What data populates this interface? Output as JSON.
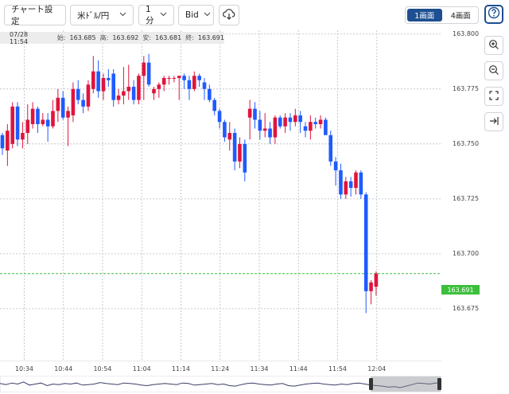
{
  "toolbar": {
    "chart_settings": "チャート設定",
    "pair": "米ﾄﾞﾙ/円",
    "timeframe": "1分",
    "price_type": "Bid",
    "layout_1": "1画面",
    "layout_4": "4画面"
  },
  "ohlc": {
    "datetime": "07/28 11:54",
    "open_label": "始:",
    "open": "163.685",
    "high_label": "高:",
    "high": "163.692",
    "low_label": "安:",
    "low": "163.681",
    "close_label": "終:",
    "close": "163.691"
  },
  "current_price": "163.691",
  "colors": {
    "up": "#e0143c",
    "down": "#1f5bff",
    "grid": "#b8bcc4",
    "current": "#3cc03c",
    "accent": "#1d4f91"
  },
  "icons": [
    "chevron-down-icon",
    "cloud-download-icon",
    "help-icon",
    "zoom-in-icon",
    "zoom-out-icon",
    "fit-icon",
    "scroll-end-icon"
  ],
  "chart_data": {
    "type": "candlestick",
    "interval": "1 minute",
    "y_ticks": [
      "163.800",
      "163.775",
      "163.750",
      "163.725",
      "163.700",
      "163.675"
    ],
    "ylim": [
      163.667,
      163.801
    ],
    "x_ticks": [
      "10:34",
      "10:44",
      "10:54",
      "11:04",
      "11:14",
      "11:24",
      "11:34",
      "11:44",
      "11:54",
      "12:04"
    ],
    "candles": [
      [
        163.754,
        163.755,
        163.745,
        163.748
      ],
      [
        163.747,
        163.759,
        163.74,
        163.756
      ],
      [
        163.75,
        163.769,
        163.748,
        163.767
      ],
      [
        163.767,
        163.769,
        163.749,
        163.752
      ],
      [
        163.752,
        163.76,
        163.748,
        163.755
      ],
      [
        163.755,
        163.768,
        163.75,
        163.761
      ],
      [
        163.759,
        163.769,
        163.757,
        163.766
      ],
      [
        163.766,
        163.767,
        163.755,
        163.759
      ],
      [
        163.759,
        163.764,
        163.758,
        163.761
      ],
      [
        163.761,
        163.764,
        163.751,
        163.758
      ],
      [
        163.758,
        163.77,
        163.757,
        163.765
      ],
      [
        163.765,
        163.775,
        163.76,
        163.771
      ],
      [
        163.771,
        163.774,
        163.761,
        163.762
      ],
      [
        163.762,
        163.767,
        163.749,
        163.765
      ],
      [
        163.763,
        163.778,
        163.76,
        163.775
      ],
      [
        163.775,
        163.779,
        163.768,
        163.77
      ],
      [
        163.77,
        163.773,
        163.764,
        163.767
      ],
      [
        163.767,
        163.779,
        163.765,
        163.777
      ],
      [
        163.775,
        163.79,
        163.773,
        163.783
      ],
      [
        163.783,
        163.788,
        163.771,
        163.774
      ],
      [
        163.774,
        163.782,
        163.77,
        163.78
      ],
      [
        163.78,
        163.784,
        163.776,
        163.779
      ],
      [
        163.782,
        163.784,
        163.767,
        163.77
      ],
      [
        163.77,
        163.775,
        163.768,
        163.772
      ],
      [
        163.772,
        163.785,
        163.768,
        163.774
      ],
      [
        163.774,
        163.786,
        163.77,
        163.776
      ],
      [
        163.776,
        163.779,
        163.768,
        163.77
      ],
      [
        163.77,
        163.782,
        163.768,
        163.781
      ],
      [
        163.781,
        163.79,
        163.77,
        163.787
      ],
      [
        163.787,
        163.791,
        163.776,
        163.777
      ],
      [
        163.773,
        163.776,
        163.77,
        163.775
      ],
      [
        163.775,
        163.778,
        163.771,
        163.777
      ],
      [
        163.777,
        163.781,
        163.774,
        163.78
      ],
      [
        163.78,
        163.781,
        163.777,
        163.78
      ],
      [
        163.78,
        163.781,
        163.778,
        163.78
      ],
      [
        163.78,
        163.781,
        163.77,
        163.781
      ],
      [
        163.781,
        163.782,
        163.775,
        163.779
      ],
      [
        163.779,
        163.781,
        163.77,
        163.775
      ],
      [
        163.775,
        163.783,
        163.774,
        163.781
      ],
      [
        163.781,
        163.782,
        163.776,
        163.779
      ],
      [
        163.778,
        163.78,
        163.77,
        163.775
      ],
      [
        163.775,
        163.777,
        163.769,
        163.77
      ],
      [
        163.77,
        163.771,
        163.763,
        163.765
      ],
      [
        163.765,
        163.766,
        163.757,
        163.76
      ],
      [
        163.76,
        163.761,
        163.751,
        163.753
      ],
      [
        163.752,
        163.76,
        163.747,
        163.755
      ],
      [
        163.755,
        163.757,
        163.738,
        163.742
      ],
      [
        163.742,
        163.753,
        163.739,
        163.75
      ],
      [
        163.75,
        163.752,
        163.733,
        163.737
      ],
      [
        163.762,
        163.77,
        163.752,
        163.766
      ],
      [
        163.766,
        163.769,
        163.757,
        163.761
      ],
      [
        163.761,
        163.765,
        163.752,
        163.756
      ],
      [
        163.756,
        163.764,
        163.753,
        163.757
      ],
      [
        163.757,
        163.76,
        163.75,
        163.753
      ],
      [
        163.753,
        163.763,
        163.75,
        163.762
      ],
      [
        163.762,
        163.763,
        163.757,
        163.758
      ],
      [
        163.758,
        163.764,
        163.755,
        163.762
      ],
      [
        163.762,
        163.764,
        163.756,
        163.76
      ],
      [
        163.76,
        163.766,
        163.758,
        163.763
      ],
      [
        163.763,
        163.765,
        163.755,
        163.76
      ],
      [
        163.758,
        163.76,
        163.753,
        163.756
      ],
      [
        163.756,
        163.763,
        163.752,
        163.76
      ],
      [
        163.76,
        163.762,
        163.757,
        163.759
      ],
      [
        163.759,
        163.763,
        163.757,
        163.761
      ],
      [
        163.761,
        163.762,
        163.755,
        163.754
      ],
      [
        163.754,
        163.756,
        163.74,
        163.742
      ],
      [
        163.742,
        163.744,
        163.731,
        163.738
      ],
      [
        163.738,
        163.741,
        163.725,
        163.727
      ],
      [
        163.727,
        163.735,
        163.725,
        163.733
      ],
      [
        163.733,
        163.735,
        163.726,
        163.73
      ],
      [
        163.73,
        163.738,
        163.727,
        163.737
      ],
      [
        163.737,
        163.738,
        163.725,
        163.727
      ],
      [
        163.727,
        163.728,
        163.673,
        163.683
      ],
      [
        163.683,
        163.688,
        163.677,
        163.687
      ],
      [
        163.685,
        163.692,
        163.681,
        163.691
      ]
    ]
  },
  "navigator_series": [
    0.55,
    0.45,
    0.6,
    0.5,
    0.7,
    0.4,
    0.5,
    0.6,
    0.35,
    0.5,
    0.45,
    0.55,
    0.5,
    0.6,
    0.4,
    0.45,
    0.5,
    0.65,
    0.55,
    0.5,
    0.45,
    0.6,
    0.55,
    0.5,
    0.4,
    0.35,
    0.45,
    0.5,
    0.55,
    0.5,
    0.45,
    0.6,
    0.55,
    0.4,
    0.45,
    0.5,
    0.55,
    0.45,
    0.5,
    0.35,
    0.3,
    0.45,
    0.55,
    0.6,
    0.5,
    0.45,
    0.4,
    0.5,
    0.55,
    0.35,
    0.3,
    0.4,
    0.5,
    0.55,
    0.6,
    0.5,
    0.45,
    0.4,
    0.5,
    0.45,
    0.55,
    0.6,
    0.5,
    0.4,
    0.35,
    0.3,
    0.2,
    0.25,
    0.15,
    0.3,
    0.45,
    0.6,
    0.55,
    0.5,
    0.6,
    0.65
  ]
}
